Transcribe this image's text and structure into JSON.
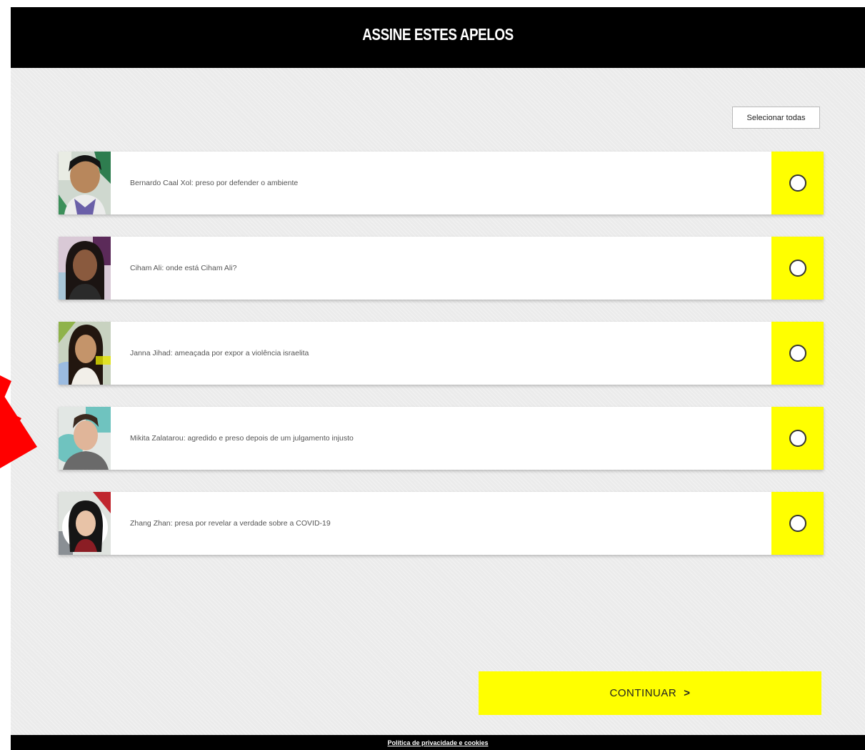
{
  "header": {
    "title": "ASSINE ESTES APELOS"
  },
  "select_all_label": "Selecionar todas",
  "appeals": [
    {
      "label": "Bernardo Caal Xol: preso por defender o ambiente",
      "avatar": "bernardo-photo"
    },
    {
      "label": "Ciham Ali: onde está Ciham Ali?",
      "avatar": "ciham-photo"
    },
    {
      "label": "Janna Jihad: ameaçada por expor a violência israelita",
      "avatar": "janna-photo"
    },
    {
      "label": "Mikita Zalatarou: agredido e preso depois de um julgamento injusto",
      "avatar": "mikita-photo"
    },
    {
      "label": "Zhang Zhan: presa por revelar a verdade sobre a COVID-19",
      "avatar": "zhang-photo"
    }
  ],
  "continue_label": "CONTINUAR",
  "continue_arrow": ">",
  "footer": {
    "privacy_link": "Política de privacidade e cookies"
  },
  "colors": {
    "accent": "#ffff00",
    "header_bg": "#000000",
    "page_bg": "#ebebeb",
    "annotation_arrow": "#ff0000"
  }
}
